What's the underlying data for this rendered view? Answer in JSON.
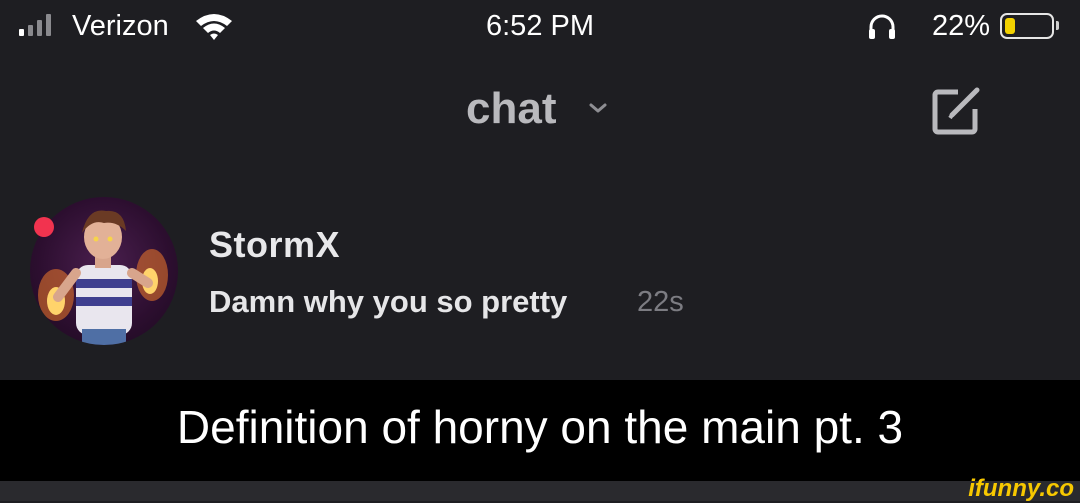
{
  "status_bar": {
    "carrier": "Verizon",
    "time": "6:52 PM",
    "battery_percent": "22%",
    "battery_level": 0.22,
    "icons": [
      "signal-icon",
      "wifi-icon",
      "headphones-icon",
      "battery-icon"
    ]
  },
  "header": {
    "title": "chat",
    "icons": [
      "chevron-down-icon",
      "compose-icon"
    ]
  },
  "chat": {
    "name": "StormX",
    "preview": "Damn why you so pretty",
    "time": "22s",
    "presence_color": "#f2334f"
  },
  "caption": "Definition of horny on the main pt. 3",
  "watermark": "ifunny.co"
}
